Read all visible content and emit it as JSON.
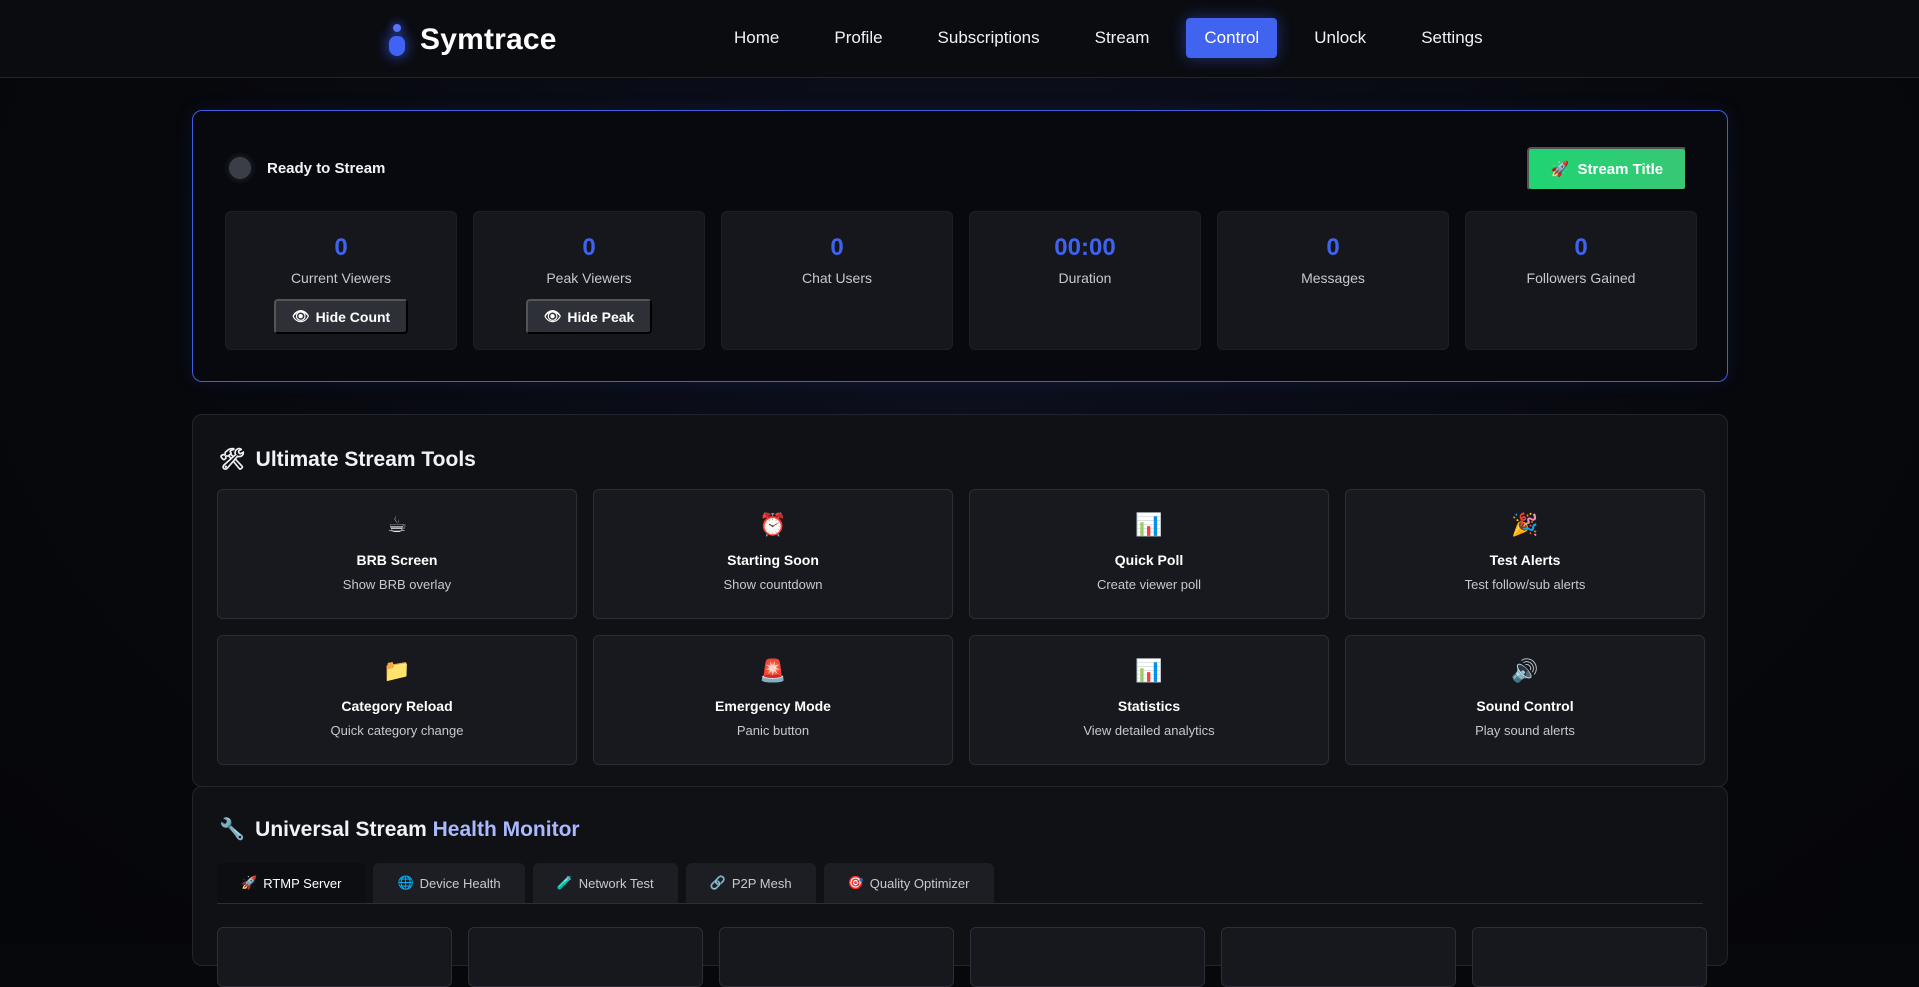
{
  "brand": {
    "name": "Symtrace",
    "accent": "#4063f0"
  },
  "nav": {
    "items": [
      {
        "label": "Home",
        "active": false
      },
      {
        "label": "Profile",
        "active": false
      },
      {
        "label": "Subscriptions",
        "active": false
      },
      {
        "label": "Stream",
        "active": false
      },
      {
        "label": "Control",
        "active": true
      },
      {
        "label": "Unlock",
        "active": false
      },
      {
        "label": "Settings",
        "active": false
      }
    ]
  },
  "status": {
    "text": "Ready to Stream",
    "title_button": "Stream Title",
    "title_button_icon": "🚀",
    "title_button_color": "#1fd473"
  },
  "stats": [
    {
      "value": "0",
      "label": "Current Viewers",
      "button": "Hide Count",
      "button_icon": "👁"
    },
    {
      "value": "0",
      "label": "Peak Viewers",
      "button": "Hide Peak",
      "button_icon": "👁"
    },
    {
      "value": "0",
      "label": "Chat Users"
    },
    {
      "value": "00:00",
      "label": "Duration"
    },
    {
      "value": "0",
      "label": "Messages"
    },
    {
      "value": "0",
      "label": "Followers Gained"
    }
  ],
  "tools": {
    "title_icon": "🛠",
    "title": "Ultimate Stream Tools",
    "items": [
      {
        "icon": "☕",
        "name": "BRB Screen",
        "desc": "Show BRB overlay"
      },
      {
        "icon": "⏰",
        "name": "Starting Soon",
        "desc": "Show countdown"
      },
      {
        "icon": "📊",
        "name": "Quick Poll",
        "desc": "Create viewer poll"
      },
      {
        "icon": "🎉",
        "name": "Test Alerts",
        "desc": "Test follow/sub alerts"
      },
      {
        "icon": "📁",
        "name": "Category Reload",
        "desc": "Quick category change"
      },
      {
        "icon": "🚨",
        "name": "Emergency Mode",
        "desc": "Panic button"
      },
      {
        "icon": "📊",
        "name": "Statistics",
        "desc": "View detailed analytics"
      },
      {
        "icon": "🔊",
        "name": "Sound Control",
        "desc": "Play sound alerts"
      }
    ]
  },
  "health": {
    "title_icon": "🔧",
    "title_part1": "Universal Stream ",
    "title_part2": "Health Monitor",
    "tabs": [
      {
        "icon": "🚀",
        "label": "RTMP Server",
        "active": true
      },
      {
        "icon": "🌐",
        "label": "Device Health",
        "active": false
      },
      {
        "icon": "🧪",
        "label": "Network Test",
        "active": false
      },
      {
        "icon": "🔗",
        "label": "P2P Mesh",
        "active": false
      },
      {
        "icon": "🎯",
        "label": "Quality Optimizer",
        "active": false
      }
    ]
  }
}
